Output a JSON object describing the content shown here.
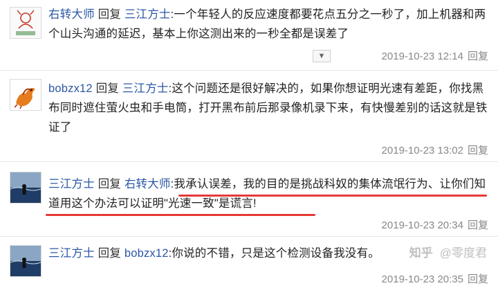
{
  "replies": [
    {
      "author": "右转大师",
      "reply_word": "回复",
      "target": "三江方士",
      "content": ":一个年轻人的反应速度都要花点五分之一秒了，加上机器和两个山头沟通的延迟，基本上你这测出来的一秒全都是误差了",
      "timestamp": "2019-10-23 12:14",
      "reply_label": "回复",
      "avatar_icon": "cartoon-avatar-icon"
    },
    {
      "author": "bobzx12",
      "reply_word": "回复",
      "target": "三江方士",
      "content": ":这个问题还是很好解决的，如果你想证明光速有差距，你找黑布同时遮住萤火虫和手电筒，打开黑布前后那录像机录下来，有快慢差别的话这就是铁证了",
      "timestamp": "2019-10-23 13:02",
      "reply_label": "回复",
      "avatar_icon": "dragon-avatar-icon"
    },
    {
      "author": "三江方士",
      "reply_word": "回复",
      "target": "右转大师",
      "content": ":我承认误差，我的目的是挑战科奴的集体流氓行为、让你们知道用这个办法可以证明\"光速一致\"是谎言!",
      "timestamp": "2019-10-23 20:34",
      "reply_label": "回复",
      "avatar_icon": "sea-avatar-icon"
    },
    {
      "author": "三江方士",
      "reply_word": "回复",
      "target": "bobzx12",
      "content": ":你说的不错，只是这个检测设备我没有。",
      "timestamp": "2019-10-23 20:35",
      "reply_label": "回复",
      "avatar_icon": "sea-avatar-icon"
    }
  ],
  "collapse_icon": "triangle-down-icon",
  "watermark": {
    "logo": "知乎",
    "user": "@零度君"
  },
  "colors": {
    "link": "#2a57a6",
    "meta": "#888888",
    "highlight": "#e53935"
  }
}
